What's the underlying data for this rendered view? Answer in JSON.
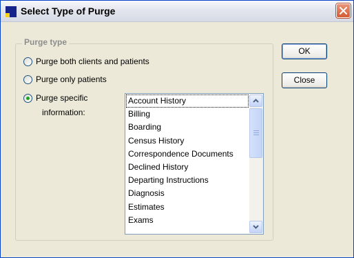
{
  "window": {
    "title": "Select Type of Purge",
    "colors": {
      "face": "#ece9d8",
      "frame": "#0842c6",
      "close": "#d35b34"
    }
  },
  "group": {
    "label": "Purge type",
    "options": [
      {
        "label": "Purge both clients and patients",
        "checked": false
      },
      {
        "label": "Purge only patients",
        "checked": false
      },
      {
        "label_line1": "Purge specific",
        "label_line2": "information:",
        "checked": true
      }
    ]
  },
  "list": {
    "items": [
      "Account History",
      "Billing",
      "Boarding",
      "Census History",
      "Correspondence Documents",
      "Declined History",
      "Departing Instructions",
      "Diagnosis",
      "Estimates",
      "Exams"
    ],
    "focused_index": 0
  },
  "buttons": {
    "ok": "OK",
    "close": "Close"
  }
}
